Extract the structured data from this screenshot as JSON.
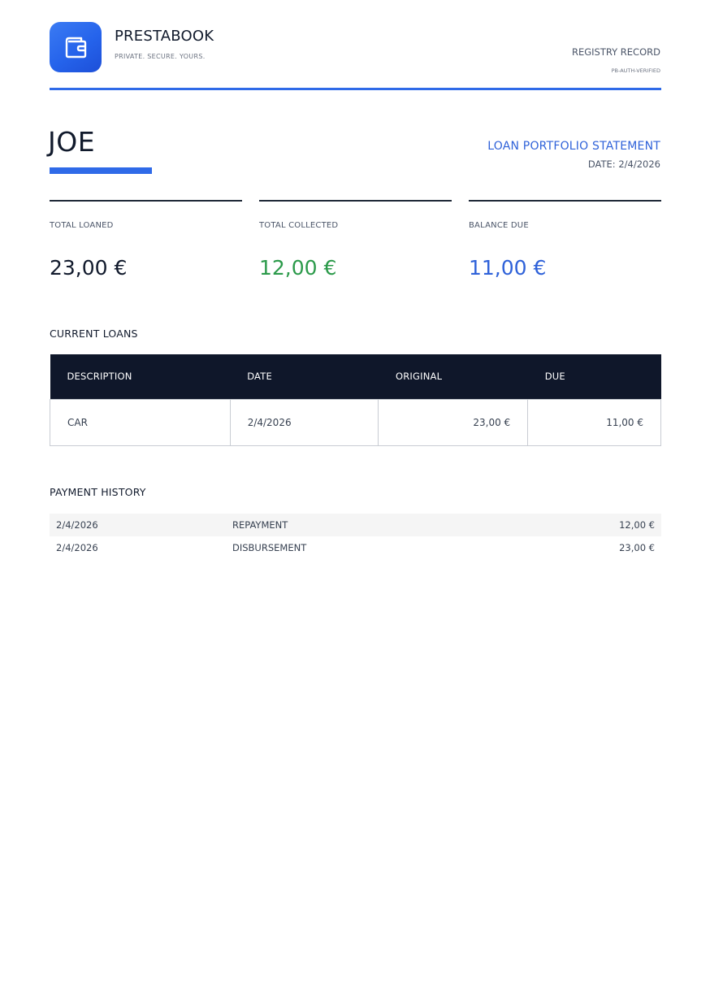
{
  "header": {
    "brand_name": "PRESTABOOK",
    "brand_tagline": "PRIVATE. SECURE. YOURS.",
    "registry_label": "REGISTRY RECORD",
    "verification_code": "PB-AUTH-VERIFIED",
    "logo_icon": "wallet-icon"
  },
  "client": {
    "name": "JOE"
  },
  "statement": {
    "title": "LOAN PORTFOLIO STATEMENT",
    "date": "DATE: 2/4/2026"
  },
  "summary": [
    {
      "label": "TOTAL LOANED",
      "value": "23,00 €"
    },
    {
      "label": "TOTAL COLLECTED",
      "value": "12,00 €"
    },
    {
      "label": "BALANCE DUE",
      "value": "11,00 €"
    }
  ],
  "current_loans": {
    "title": "CURRENT LOANS",
    "columns": [
      "DESCRIPTION",
      "DATE",
      "ORIGINAL",
      "DUE"
    ],
    "rows": [
      {
        "description": "CAR",
        "date": "2/4/2026",
        "original": "23,00 €",
        "due": "11,00 €"
      }
    ]
  },
  "payment_history": {
    "title": "PAYMENT HISTORY",
    "rows": [
      {
        "date": "2/4/2026",
        "type": "REPAYMENT",
        "amount": "12,00 €"
      },
      {
        "date": "2/4/2026",
        "type": "DISBURSEMENT",
        "amount": "23,00 €"
      }
    ]
  },
  "colors": {
    "accent": "#2f6ae8",
    "table_header": "#0f172a",
    "collected": "#2b9a4a",
    "balance": "#2f62d9"
  }
}
